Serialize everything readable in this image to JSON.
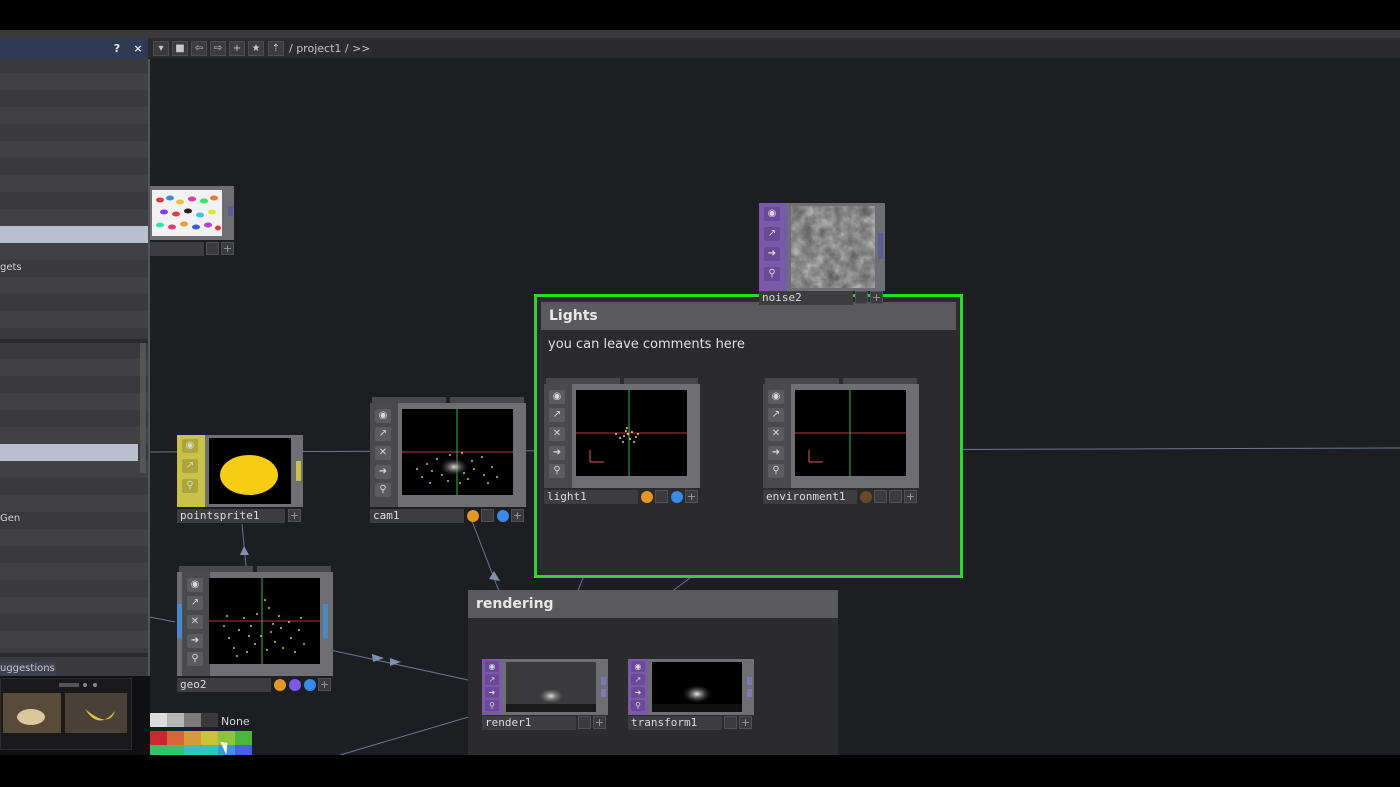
{
  "toolbar": {
    "help_label": "?",
    "close_label": "×",
    "breadcrumb": "/ project1 / >>"
  },
  "left_panel": {
    "items": [
      {
        "label": "gets"
      },
      {
        "label": "Gen"
      }
    ],
    "suggestions_tab": "uggestions"
  },
  "comments": {
    "lights": {
      "title": "Lights",
      "text": "you can leave comments here",
      "border_color": "#2fd52f"
    },
    "rendering": {
      "title": "rendering"
    }
  },
  "nodes": {
    "noise2": {
      "name": "noise2",
      "family_color": "#7a5aa8"
    },
    "light1": {
      "name": "light1"
    },
    "environment1": {
      "name": "environment1"
    },
    "pointsprite1": {
      "name": "pointsprite1",
      "family_color": "#c8c24a"
    },
    "cam1": {
      "name": "cam1"
    },
    "geo2": {
      "name": "geo2"
    },
    "render1": {
      "name": "render1",
      "family_color": "#7a5aa8"
    },
    "transform1": {
      "name": "transform1",
      "family_color": "#7a5aa8"
    }
  },
  "palette": {
    "none_label": "None",
    "colors": [
      "#dcdcdc",
      "#b5b5b5",
      "#7d7d7d",
      "#3a3a3a",
      "#c8282e",
      "#d9653a",
      "#d89a3a",
      "#c9c238",
      "#8fc43a",
      "#49b83a",
      "#2fc46a",
      "#31c4b8",
      "#3a96d8",
      "#4a62d8"
    ]
  }
}
